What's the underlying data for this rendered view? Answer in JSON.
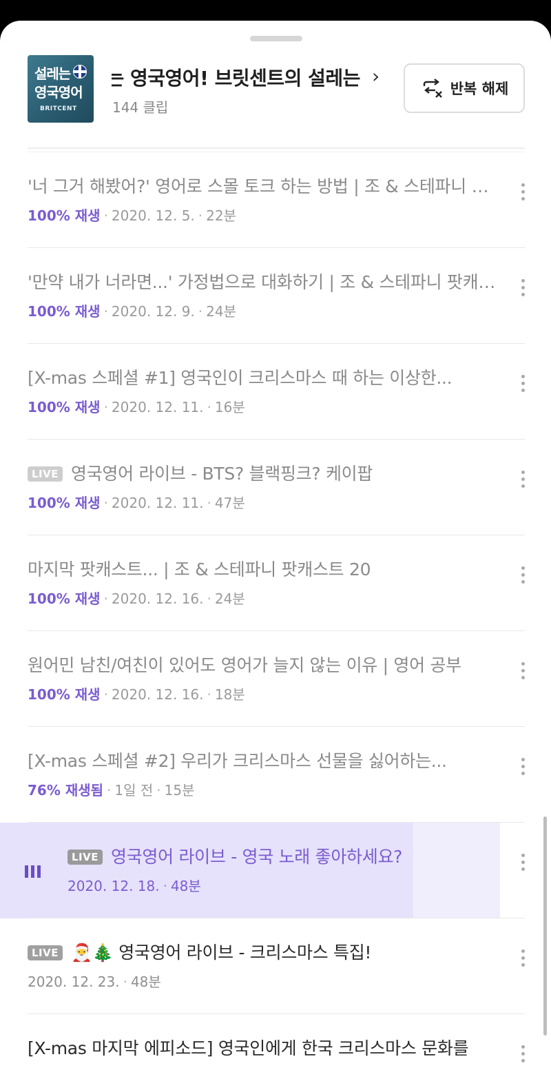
{
  "playlist": {
    "thumb_line1": "설레는",
    "thumb_line2": "영국영어",
    "thumb_brand": "BRITCENT",
    "title": "설레는 영국영어!     브릿센트의 설레는",
    "clip_count": "144 클립",
    "repeat_button_label": "반복 해제"
  },
  "live_label": "LIVE",
  "episodes": [
    {
      "title": "'너 그거 해봤어?' 영어로 스몰 토크 하는 방법 | 조 & 스테파니 팟캐스트",
      "progress": "100% 재생",
      "date": "2020. 12. 5.",
      "duration": "22분"
    },
    {
      "title": "'만약 내가 너라면...' 가정법으로 대화하기 | 조 & 스테파니 팟캐스트",
      "progress": "100% 재생",
      "date": "2020. 12. 9.",
      "duration": "24분"
    },
    {
      "title": "[X-mas 스페셜 #1] 영국인이 크리스마스 때 하는 이상한...",
      "progress": "100% 재생",
      "date": "2020. 12. 11.",
      "duration": "16분"
    },
    {
      "title": "영국영어 라이브 - BTS? 블랙핑크? 케이팝",
      "progress": "100% 재생",
      "date": "2020. 12. 11.",
      "duration": "47분",
      "live": true
    },
    {
      "title": "마지막 팟캐스트... | 조 & 스테파니 팟캐스트 20",
      "progress": "100% 재생",
      "date": "2020. 12. 16.",
      "duration": "24분"
    },
    {
      "title": "원어민 남친/여친이 있어도 영어가 늘지 않는 이유 | 영어 공부",
      "progress": "100% 재생",
      "date": "2020. 12. 16.",
      "duration": "18분"
    },
    {
      "title": "[X-mas 스페셜 #2] 우리가 크리스마스 선물을 싫어하는...",
      "progress": "76% 재생됨",
      "date": "1일 전",
      "duration": "15분"
    },
    {
      "title": "영국영어 라이브 - 영국 노래 좋아하세요?",
      "date": "2020. 12. 18.",
      "duration": "48분",
      "live": true,
      "playing": true
    },
    {
      "title": "🎅🎄 영국영어 라이브 - 크리스마스 특집!",
      "date": "2020. 12. 23.",
      "duration": "48분",
      "live": true
    },
    {
      "title": "[X-mas 마지막 에피소드] 영국인에게 한국 크리스마스 문화를",
      "date": "",
      "duration": ""
    }
  ]
}
